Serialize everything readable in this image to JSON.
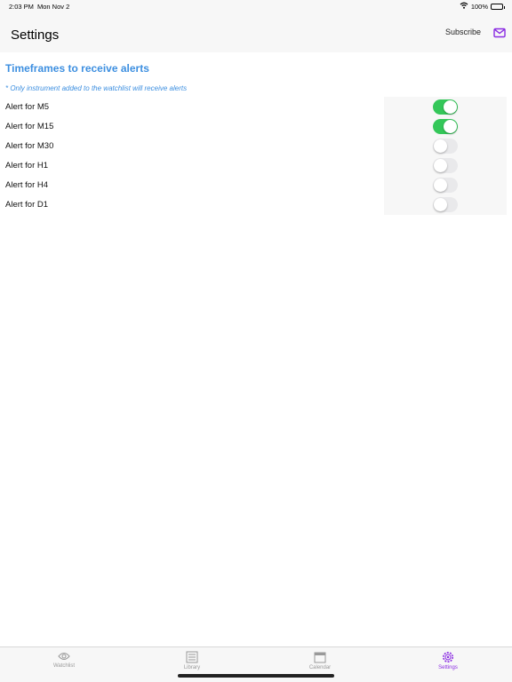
{
  "status_bar": {
    "time": "2:03 PM",
    "date": "Mon Nov 2",
    "battery": "100%",
    "wifi_icon": "wifi-icon",
    "battery_icon": "battery-icon"
  },
  "nav": {
    "title": "Settings",
    "subscribe_label": "Subscribe",
    "mail_icon": "mail-icon"
  },
  "alerts": {
    "title": "Timeframes to receive alerts",
    "note": "* Only instrument added to the watchlist will receive alerts",
    "items": [
      {
        "label": "Alert for M5",
        "on": true
      },
      {
        "label": "Alert for M15",
        "on": true
      },
      {
        "label": "Alert for M30",
        "on": false
      },
      {
        "label": "Alert for H1",
        "on": false
      },
      {
        "label": "Alert for H4",
        "on": false
      },
      {
        "label": "Alert for D1",
        "on": false
      }
    ]
  },
  "colors": {
    "accent_blue": "#3d8fe0",
    "switch_on": "#34c759",
    "switch_off": "#e9e9eb",
    "active_tab": "#8a2be2"
  },
  "tabs": [
    {
      "label": "Watchlist",
      "icon": "eye-icon",
      "active": false
    },
    {
      "label": "Library",
      "icon": "list-icon",
      "active": false
    },
    {
      "label": "Calendar",
      "icon": "calendar-icon",
      "active": false
    },
    {
      "label": "Settings",
      "icon": "gear-icon",
      "active": true
    }
  ]
}
